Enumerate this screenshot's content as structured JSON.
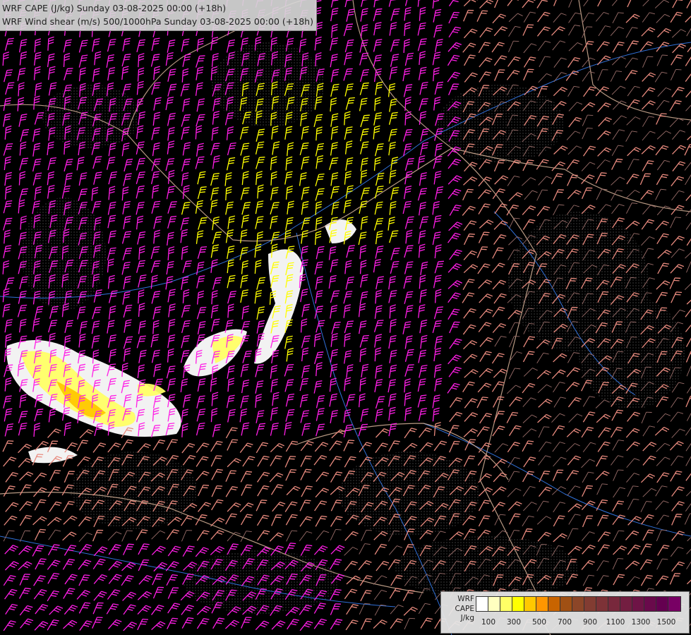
{
  "titles": {
    "line1": "WRF CAPE (J/kg) Sunday 03-08-2025 00:00 (+18h)",
    "line2": "WRF Wind shear (m/s) 500/1000hPa Sunday 03-08-2025 00:00 (+18h)"
  },
  "legend": {
    "label_1": "WRF",
    "label_2": "CAPE",
    "label_3": "J/kg",
    "colors": [
      "#ffffff",
      "#ffffc0",
      "#ffff66",
      "#ffff00",
      "#ffc800",
      "#ff9600",
      "#c86400",
      "#a05014",
      "#8c4628",
      "#823c32",
      "#7d3237",
      "#78283c",
      "#731e41",
      "#6e1446",
      "#690a4b",
      "#640050",
      "#780064"
    ],
    "ticks": [
      "100",
      "300",
      "500",
      "700",
      "900",
      "1100",
      "1300",
      "1500"
    ]
  },
  "barb_colors": {
    "weak": "#9a6e6a",
    "moderate": "#e88a7e",
    "strong": "#ff1ee6",
    "very_strong": "#ffff00"
  },
  "map_colors": {
    "background": "#000000",
    "borders": "#d8b49a",
    "rivers": "#3070d8",
    "terrain": "#888888"
  }
}
